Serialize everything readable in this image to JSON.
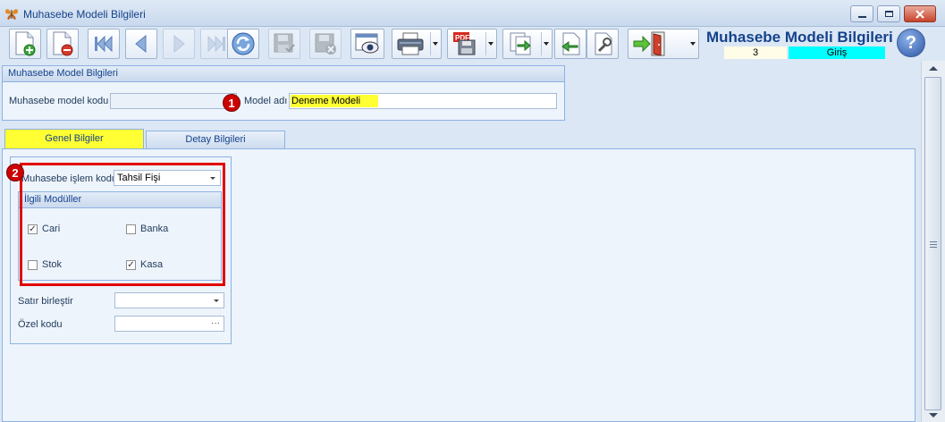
{
  "window": {
    "title": "Muhasebe Modeli Bilgileri"
  },
  "header": {
    "title": "Muhasebe Modeli Bilgileri",
    "record_number": "3",
    "mode": "Giriş",
    "help_label": "?"
  },
  "toolbar": {
    "buttons": [
      {
        "name": "new-record-icon"
      },
      {
        "name": "delete-record-icon"
      },
      {
        "name": "first-record-icon"
      },
      {
        "name": "previous-record-icon"
      },
      {
        "name": "next-record-icon"
      },
      {
        "name": "last-record-icon"
      },
      {
        "name": "refresh-icon"
      },
      {
        "name": "save-icon"
      },
      {
        "name": "cancel-save-icon"
      },
      {
        "name": "preview-icon"
      },
      {
        "name": "printer-icon"
      },
      {
        "name": "pdf-export-icon"
      },
      {
        "name": "export-icon"
      },
      {
        "name": "import-icon"
      },
      {
        "name": "settings-tools-icon"
      },
      {
        "name": "exit-door-icon"
      }
    ]
  },
  "model_group": {
    "title": "Muhasebe Model Bilgileri",
    "code_label": "Muhasebe model kodu",
    "code_value": "",
    "name_label": "Model adı",
    "name_value": "Deneme Modeli",
    "badge": "1"
  },
  "tabs": [
    {
      "label": "Genel Bilgiler",
      "active": true
    },
    {
      "label": "Detay Bilgileri",
      "active": false
    }
  ],
  "general": {
    "badge": "2",
    "transaction_code_label": "Muhasebe işlem kodu",
    "transaction_code_value": "Tahsil Fişi",
    "modules_title": "İlgili Modüller",
    "modules": [
      {
        "label": "Cari",
        "checked": true
      },
      {
        "label": "Banka",
        "checked": false
      },
      {
        "label": "Stok",
        "checked": false
      },
      {
        "label": "Kasa",
        "checked": true
      }
    ],
    "merge_lines_label": "Satır birleştir",
    "merge_lines_value": "",
    "special_code_label": "Özel kodu",
    "special_code_value": ""
  },
  "colors": {
    "accent": "#15428b",
    "highlight": "#ffff33",
    "mode_badge": "#00ffff",
    "annotation": "#e10000"
  }
}
